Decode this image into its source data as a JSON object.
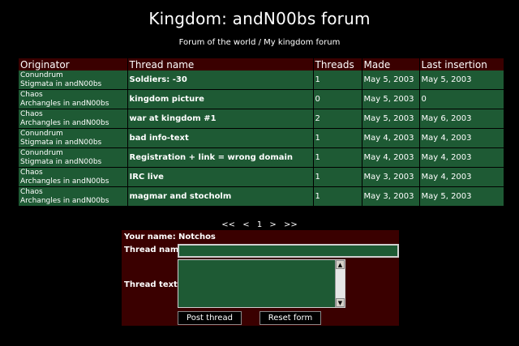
{
  "page": {
    "title": "Kingdom: andN00bs forum",
    "nav_forum_world": "Forum of the world",
    "nav_sep": " / ",
    "nav_my_kingdom": "My kingdom forum"
  },
  "table": {
    "headers": [
      "Originator",
      "Thread name",
      "Threads",
      "Made",
      "Last insertion"
    ],
    "rows": [
      {
        "user": "Conundrum",
        "guild": "Stigmata in andN00bs",
        "thread": "Soldiers: -30",
        "count": "1",
        "made": "May 5, 2003",
        "last": "May 5, 2003"
      },
      {
        "user": "Chaos",
        "guild": "Archangles in andN00bs",
        "thread": "kingdom picture",
        "count": "0",
        "made": "May 5, 2003",
        "last": "0"
      },
      {
        "user": "Chaos",
        "guild": "Archangles in andN00bs",
        "thread": "war at kingdom #1",
        "count": "2",
        "made": "May 5, 2003",
        "last": "May 6, 2003"
      },
      {
        "user": "Conundrum",
        "guild": "Stigmata in andN00bs",
        "thread": "bad info-text",
        "count": "1",
        "made": "May 4, 2003",
        "last": "May 4, 2003"
      },
      {
        "user": "Conundrum",
        "guild": "Stigmata in andN00bs",
        "thread": "Registration + link = wrong domain",
        "count": "1",
        "made": "May 4, 2003",
        "last": "May 4, 2003"
      },
      {
        "user": "Chaos",
        "guild": "Archangles in andN00bs",
        "thread": "IRC live",
        "count": "1",
        "made": "May 3, 2003",
        "last": "May 4, 2003"
      },
      {
        "user": "Chaos",
        "guild": "Archangles in andN00bs",
        "thread": "magmar and stocholm",
        "count": "1",
        "made": "May 3, 2003",
        "last": "May 5, 2003"
      }
    ]
  },
  "pager": {
    "first": "<<",
    "prev": "<",
    "current": "1",
    "next": ">",
    "last": ">>"
  },
  "form": {
    "your_name_label": "Your name:",
    "your_name_value": "Notchos",
    "thread_name_label": "Thread name:",
    "thread_name_value": "",
    "thread_text_label": "Thread text:",
    "thread_text_value": "",
    "post_button": "Post thread",
    "reset_button": "Reset form"
  },
  "colors": {
    "row_bg": "#1e5a34",
    "header_bg": "#3a0000",
    "page_bg": "#000000"
  }
}
